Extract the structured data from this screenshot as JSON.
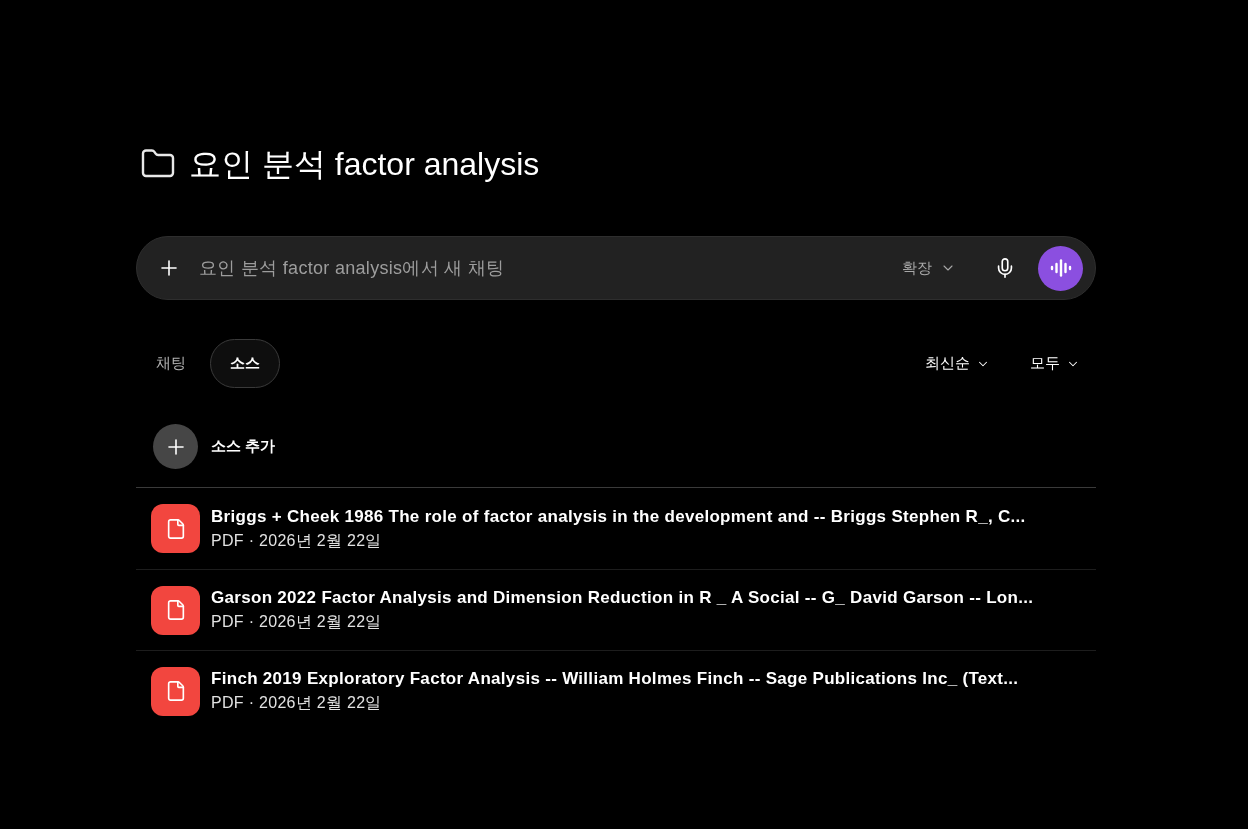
{
  "folder": {
    "title": "요인 분석 factor analysis"
  },
  "composer": {
    "placeholder": "요인 분석 factor analysis에서 새 채팅",
    "mode": "확장"
  },
  "tabs": [
    {
      "label": "채팅",
      "selected": false
    },
    {
      "label": "소스",
      "selected": true
    }
  ],
  "filters": [
    {
      "label": "최신순"
    },
    {
      "label": "모두"
    }
  ],
  "add_source": {
    "label": "소스 추가"
  },
  "sources": [
    {
      "title": "Briggs + Cheek 1986 The role of factor analysis in the development and -- Briggs Stephen R_, C...",
      "meta": "PDF · 2026년 2월 22일"
    },
    {
      "title": "Garson 2022 Factor Analysis and Dimension Reduction in R _ A Social -- G_ David Garson -- Lon...",
      "meta": "PDF · 2026년 2월 22일"
    },
    {
      "title": "Finch 2019 Exploratory Factor Analysis -- William Holmes Finch -- Sage Publications Inc_ (Text...",
      "meta": "PDF · 2026년 2월 22일"
    }
  ]
}
